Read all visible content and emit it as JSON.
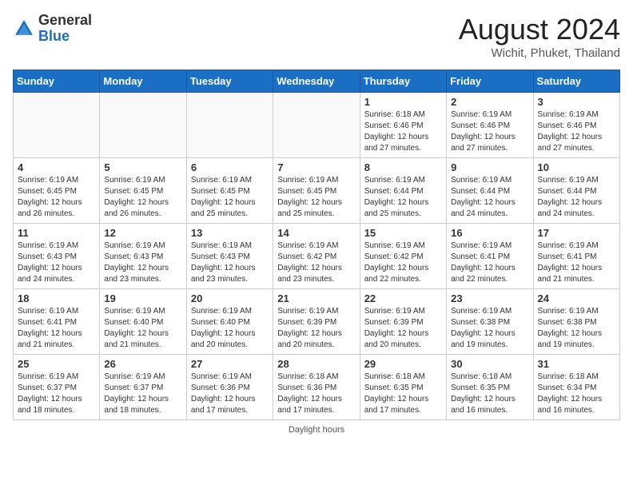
{
  "logo": {
    "general": "General",
    "blue": "Blue"
  },
  "title": "August 2024",
  "location": "Wichit, Phuket, Thailand",
  "days_header": [
    "Sunday",
    "Monday",
    "Tuesday",
    "Wednesday",
    "Thursday",
    "Friday",
    "Saturday"
  ],
  "weeks": [
    [
      {
        "day": "",
        "info": ""
      },
      {
        "day": "",
        "info": ""
      },
      {
        "day": "",
        "info": ""
      },
      {
        "day": "",
        "info": ""
      },
      {
        "day": "1",
        "info": "Sunrise: 6:18 AM\nSunset: 6:46 PM\nDaylight: 12 hours\nand 27 minutes."
      },
      {
        "day": "2",
        "info": "Sunrise: 6:19 AM\nSunset: 6:46 PM\nDaylight: 12 hours\nand 27 minutes."
      },
      {
        "day": "3",
        "info": "Sunrise: 6:19 AM\nSunset: 6:46 PM\nDaylight: 12 hours\nand 27 minutes."
      }
    ],
    [
      {
        "day": "4",
        "info": "Sunrise: 6:19 AM\nSunset: 6:45 PM\nDaylight: 12 hours\nand 26 minutes."
      },
      {
        "day": "5",
        "info": "Sunrise: 6:19 AM\nSunset: 6:45 PM\nDaylight: 12 hours\nand 26 minutes."
      },
      {
        "day": "6",
        "info": "Sunrise: 6:19 AM\nSunset: 6:45 PM\nDaylight: 12 hours\nand 25 minutes."
      },
      {
        "day": "7",
        "info": "Sunrise: 6:19 AM\nSunset: 6:45 PM\nDaylight: 12 hours\nand 25 minutes."
      },
      {
        "day": "8",
        "info": "Sunrise: 6:19 AM\nSunset: 6:44 PM\nDaylight: 12 hours\nand 25 minutes."
      },
      {
        "day": "9",
        "info": "Sunrise: 6:19 AM\nSunset: 6:44 PM\nDaylight: 12 hours\nand 24 minutes."
      },
      {
        "day": "10",
        "info": "Sunrise: 6:19 AM\nSunset: 6:44 PM\nDaylight: 12 hours\nand 24 minutes."
      }
    ],
    [
      {
        "day": "11",
        "info": "Sunrise: 6:19 AM\nSunset: 6:43 PM\nDaylight: 12 hours\nand 24 minutes."
      },
      {
        "day": "12",
        "info": "Sunrise: 6:19 AM\nSunset: 6:43 PM\nDaylight: 12 hours\nand 23 minutes."
      },
      {
        "day": "13",
        "info": "Sunrise: 6:19 AM\nSunset: 6:43 PM\nDaylight: 12 hours\nand 23 minutes."
      },
      {
        "day": "14",
        "info": "Sunrise: 6:19 AM\nSunset: 6:42 PM\nDaylight: 12 hours\nand 23 minutes."
      },
      {
        "day": "15",
        "info": "Sunrise: 6:19 AM\nSunset: 6:42 PM\nDaylight: 12 hours\nand 22 minutes."
      },
      {
        "day": "16",
        "info": "Sunrise: 6:19 AM\nSunset: 6:41 PM\nDaylight: 12 hours\nand 22 minutes."
      },
      {
        "day": "17",
        "info": "Sunrise: 6:19 AM\nSunset: 6:41 PM\nDaylight: 12 hours\nand 21 minutes."
      }
    ],
    [
      {
        "day": "18",
        "info": "Sunrise: 6:19 AM\nSunset: 6:41 PM\nDaylight: 12 hours\nand 21 minutes."
      },
      {
        "day": "19",
        "info": "Sunrise: 6:19 AM\nSunset: 6:40 PM\nDaylight: 12 hours\nand 21 minutes."
      },
      {
        "day": "20",
        "info": "Sunrise: 6:19 AM\nSunset: 6:40 PM\nDaylight: 12 hours\nand 20 minutes."
      },
      {
        "day": "21",
        "info": "Sunrise: 6:19 AM\nSunset: 6:39 PM\nDaylight: 12 hours\nand 20 minutes."
      },
      {
        "day": "22",
        "info": "Sunrise: 6:19 AM\nSunset: 6:39 PM\nDaylight: 12 hours\nand 20 minutes."
      },
      {
        "day": "23",
        "info": "Sunrise: 6:19 AM\nSunset: 6:38 PM\nDaylight: 12 hours\nand 19 minutes."
      },
      {
        "day": "24",
        "info": "Sunrise: 6:19 AM\nSunset: 6:38 PM\nDaylight: 12 hours\nand 19 minutes."
      }
    ],
    [
      {
        "day": "25",
        "info": "Sunrise: 6:19 AM\nSunset: 6:37 PM\nDaylight: 12 hours\nand 18 minutes."
      },
      {
        "day": "26",
        "info": "Sunrise: 6:19 AM\nSunset: 6:37 PM\nDaylight: 12 hours\nand 18 minutes."
      },
      {
        "day": "27",
        "info": "Sunrise: 6:19 AM\nSunset: 6:36 PM\nDaylight: 12 hours\nand 17 minutes."
      },
      {
        "day": "28",
        "info": "Sunrise: 6:18 AM\nSunset: 6:36 PM\nDaylight: 12 hours\nand 17 minutes."
      },
      {
        "day": "29",
        "info": "Sunrise: 6:18 AM\nSunset: 6:35 PM\nDaylight: 12 hours\nand 17 minutes."
      },
      {
        "day": "30",
        "info": "Sunrise: 6:18 AM\nSunset: 6:35 PM\nDaylight: 12 hours\nand 16 minutes."
      },
      {
        "day": "31",
        "info": "Sunrise: 6:18 AM\nSunset: 6:34 PM\nDaylight: 12 hours\nand 16 minutes."
      }
    ]
  ],
  "footer": "Daylight hours"
}
